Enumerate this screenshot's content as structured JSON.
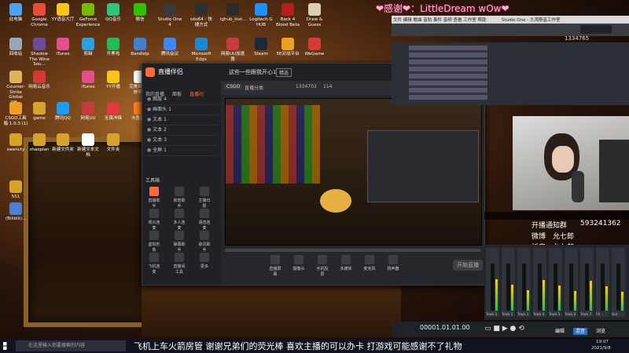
{
  "colors": {
    "accent": "#ff6a3d",
    "taskbar": "#0f141e",
    "panel": "#26272b"
  },
  "overlay": {
    "thanks_banner": "❤感谢❤：LittleDream wOw❤",
    "notify_group": "开播通知群",
    "notify_number": "593241362",
    "weibo": "微博",
    "weibo_name": "允七郎",
    "douyin": "抖音",
    "douyin_name": "允七郎",
    "ticker": "飞机上车火箭房管 谢谢兄弟们的荧光棒 喜欢主播的可以办卡 打游戏可能感谢不了礼物"
  },
  "desktop_icons": [
    {
      "label": "此电脑",
      "color": "#4aa3f0"
    },
    {
      "label": "Google Chrome",
      "color": "#e84a3c"
    },
    {
      "label": "YY语音大厅",
      "color": "#f5c518"
    },
    {
      "label": "GeForce Experience",
      "color": "#76b900"
    },
    {
      "label": "QQ音乐",
      "color": "#31c27c"
    },
    {
      "label": "微信",
      "color": "#2dc100"
    },
    {
      "label": "Studio One 4",
      "color": "#3a3a3a"
    },
    {
      "label": "obs64 - 快捷方式",
      "color": "#302e31"
    },
    {
      "label": "lghub_inst...",
      "color": "#2b2b2b"
    },
    {
      "label": "Logitech G HUB",
      "color": "#1e90ff"
    },
    {
      "label": "Back 4 Blood Beta",
      "color": "#b32020"
    },
    {
      "label": "Draw & Guess",
      "color": "#d8d0b0"
    },
    {
      "label": "回收站",
      "color": "#9aa7b5"
    },
    {
      "label": "Shadow The Wine Sou...",
      "color": "#6d4c9e"
    },
    {
      "label": "iTunes",
      "color": "#e24f8f"
    },
    {
      "label": "剪辑",
      "color": "#2aa0e0"
    },
    {
      "label": "开黑啦",
      "color": "#22bb55"
    },
    {
      "label": "Bandizip",
      "color": "#3f7fd4"
    },
    {
      "label": "腾讯会议",
      "color": "#3d86f5"
    },
    {
      "label": "Microsoft Edge",
      "color": "#1a8ad8"
    },
    {
      "label": "网易UU加速器",
      "color": "#c53c3c"
    },
    {
      "label": "Steam",
      "color": "#1b2838"
    },
    {
      "label": "5E对战平台",
      "color": "#f0a020"
    },
    {
      "label": "WeGame",
      "color": "#d43a3a"
    },
    {
      "label": "Counter-Strike Global Off...",
      "color": "#ddb45a"
    },
    {
      "label": "网易云音乐",
      "color": "#d33a31"
    },
    {
      "label": "iTunes",
      "color": "#e24f8f"
    },
    {
      "label": "YY开播",
      "color": "#f5c518"
    },
    {
      "label": "完美世界竞技平台",
      "color": "#ffffff"
    },
    {
      "label": "CSGO工具箱 1.0.3 (1)",
      "color": "#f0a020"
    },
    {
      "label": "game",
      "color": "#d6a32c"
    },
    {
      "label": "腾讯QQ",
      "color": "#1a9cff"
    },
    {
      "label": "网易UU",
      "color": "#c53c3c"
    },
    {
      "label": "无畏冲锋",
      "color": "#e03a3a"
    },
    {
      "label": "斗鱼直播",
      "color": "#ff7e1e"
    },
    {
      "label": "swencty",
      "color": "#d6a32c"
    },
    {
      "label": "zhaopian",
      "color": "#d6a32c"
    },
    {
      "label": "新建文件夹",
      "color": "#d6a32c"
    },
    {
      "label": "新建文本文档",
      "color": "#ffffff"
    },
    {
      "label": "文件夹",
      "color": "#d6a32c"
    },
    {
      "label": "551",
      "color": "#d6a32c"
    },
    {
      "label": "(Bilibili)...",
      "color": "#4a7fd6"
    }
  ],
  "obs": {
    "app_title": "直播伴侣",
    "tabs": [
      "我的直播",
      "面板",
      "直播间"
    ],
    "scene_title": "这些一些跟我开心1",
    "scene_tag": "精选",
    "game": "CSGO",
    "room_label": "直播分类",
    "viewer_count": "1334703",
    "likes": "114",
    "sources": [
      "图层 4",
      "画面头 1",
      "文本 1",
      "文本 2",
      "文本 3",
      "全屏 1"
    ],
    "tools_header": "工具箱",
    "tools": [
      "直播助手",
      "房管助手",
      "主播日报",
      "观众连麦",
      "多人连麦",
      "语音连麦",
      "虚拟形象",
      "弹幕助手",
      "歌词助手",
      "飞机连麦",
      "直播间工具",
      "更多"
    ],
    "bottom_actions": [
      "直播屏幕",
      "摄像头",
      "手机投屏",
      "多媒体",
      "麦克风",
      "扬声器"
    ],
    "start_live": "开始直播"
  },
  "daw": {
    "menu": [
      "文件",
      "编辑",
      "歌曲",
      "音轨",
      "事件",
      "音频",
      "查看",
      "工作室",
      "帮助"
    ],
    "title": "Studio One - 九湾斯音工作室",
    "view_count": "1334765",
    "channels": [
      "Track 1",
      "Track 2",
      "Track 3",
      "Track 4",
      "Track 5",
      "Track 6",
      "Track 7",
      "FX",
      "Out"
    ],
    "time": "00001.01.01.00",
    "clock_time": "19:07",
    "clock_date": "2021/9/8",
    "footer_tabs": [
      "编辑",
      "混音",
      "浏览"
    ]
  },
  "taskbar": {
    "search_placeholder": "在这里输入你要搜索的内容"
  }
}
